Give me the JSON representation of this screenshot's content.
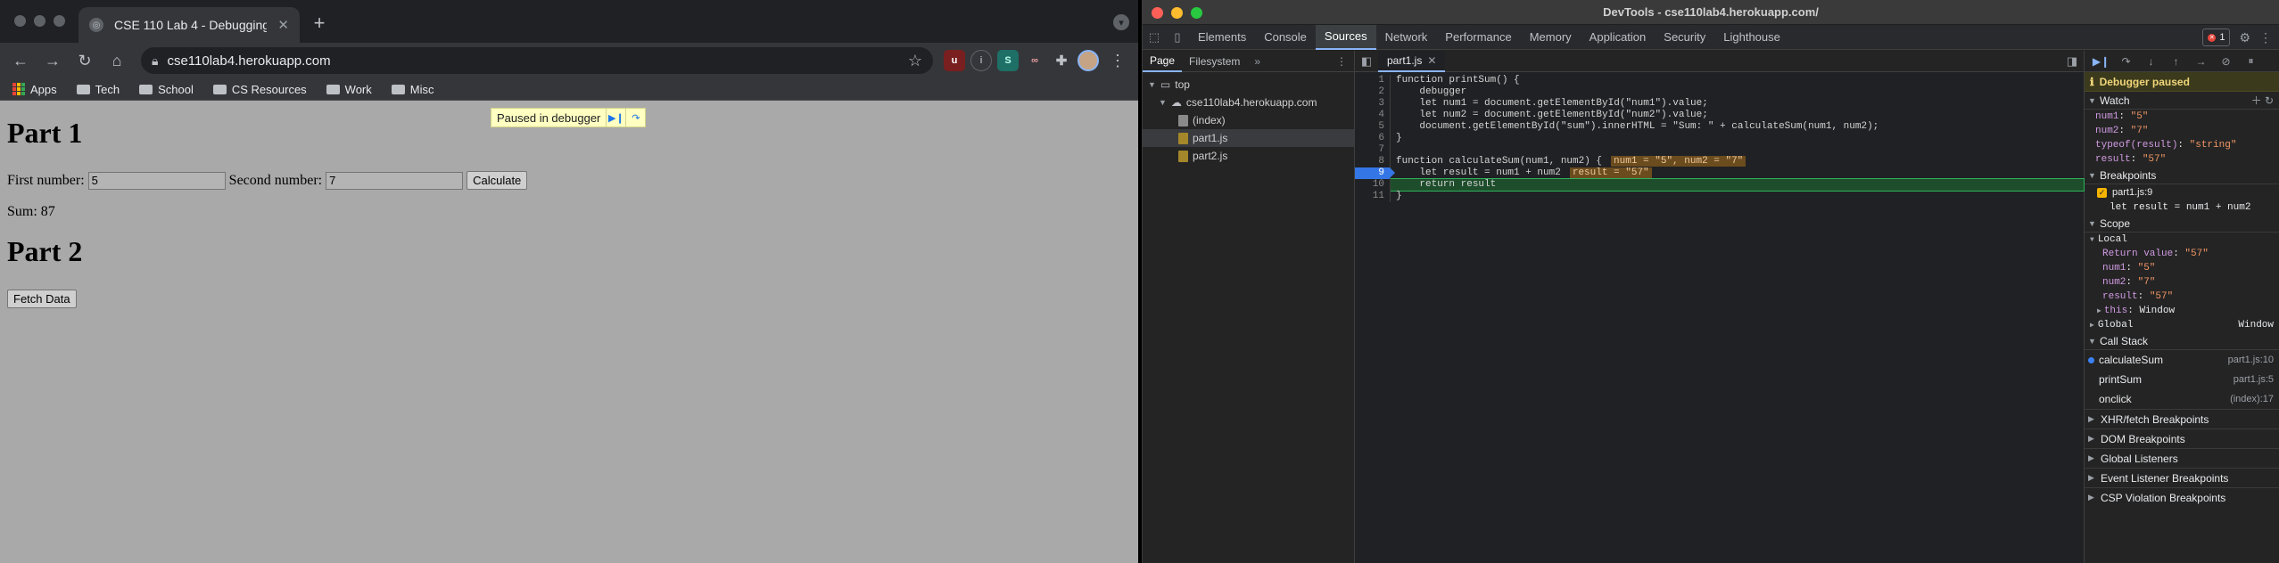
{
  "browser": {
    "tab_title": "CSE 110 Lab 4 - Debugging",
    "url": "cse110lab4.herokuapp.com",
    "bookmarks": [
      {
        "label": "Apps",
        "icon": "apps-grid-icon"
      },
      {
        "label": "Tech",
        "icon": "folder-icon"
      },
      {
        "label": "School",
        "icon": "folder-icon"
      },
      {
        "label": "CS Resources",
        "icon": "folder-icon"
      },
      {
        "label": "Work",
        "icon": "folder-icon"
      },
      {
        "label": "Misc",
        "icon": "folder-icon"
      }
    ],
    "extensions": [
      "ublock-icon",
      "extension-icon",
      "s-extension-icon",
      "glasses-extension-icon",
      "puzzle-icon"
    ]
  },
  "page": {
    "paused_label": "Paused in debugger",
    "part1_heading": "Part 1",
    "first_label": "First number:",
    "first_value": "5",
    "second_label": "Second number:",
    "second_value": "7",
    "calculate_label": "Calculate",
    "sum_text": "Sum: 87",
    "part2_heading": "Part 2",
    "fetch_label": "Fetch Data"
  },
  "devtools": {
    "window_title": "DevTools - cse110lab4.herokuapp.com/",
    "tabs": [
      "Elements",
      "Console",
      "Sources",
      "Network",
      "Performance",
      "Memory",
      "Application",
      "Security",
      "Lighthouse"
    ],
    "active_tab": "Sources",
    "error_count": "1",
    "nav_tabs": [
      "Page",
      "Filesystem"
    ],
    "tree": {
      "top": "top",
      "host": "cse110lab4.herokuapp.com",
      "files": [
        "(index)",
        "part1.js",
        "part2.js"
      ],
      "selected": "part1.js"
    },
    "editor_tab": "part1.js",
    "code": [
      {
        "n": "1",
        "text": "function printSum() {"
      },
      {
        "n": "2",
        "text": "    debugger"
      },
      {
        "n": "3",
        "text": "    let num1 = document.getElementById(\"num1\").value;"
      },
      {
        "n": "4",
        "text": "    let num2 = document.getElementById(\"num2\").value;"
      },
      {
        "n": "5",
        "text": "    document.getElementById(\"sum\").innerHTML = \"Sum: \" + calculateSum(num1, num2);"
      },
      {
        "n": "6",
        "text": "}"
      },
      {
        "n": "7",
        "text": ""
      },
      {
        "n": "8",
        "text": "function calculateSum(num1, num2) {",
        "inline": "num1 = \"5\", num2 = \"7\""
      },
      {
        "n": "9",
        "text": "    let result = num1 + num2",
        "inline": "result = \"57\"",
        "breakpoint": true
      },
      {
        "n": "10",
        "text": "    return result",
        "exec": true
      },
      {
        "n": "11",
        "text": "}"
      }
    ],
    "paused_banner": "Debugger paused",
    "watch_title": "Watch",
    "watch": [
      {
        "key": "num1",
        "value": "\"5\""
      },
      {
        "key": "num2",
        "value": "\"7\""
      },
      {
        "key": "typeof(result)",
        "value": "\"string\""
      },
      {
        "key": "result",
        "value": "\"57\""
      }
    ],
    "breakpoints_title": "Breakpoints",
    "breakpoint": {
      "file": "part1.js:9",
      "code": "let result = num1 + num2"
    },
    "scope_title": "Scope",
    "local_title": "Local",
    "locals": [
      {
        "key": "Return value",
        "value": "\"57\""
      },
      {
        "key": "num1",
        "value": "\"5\""
      },
      {
        "key": "num2",
        "value": "\"7\""
      },
      {
        "key": "result",
        "value": "\"57\""
      },
      {
        "key": "this",
        "value": "Window"
      }
    ],
    "global_title": "Global",
    "global_value": "Window",
    "callstack_title": "Call Stack",
    "frames": [
      {
        "name": "calculateSum",
        "loc": "part1.js:10",
        "current": true
      },
      {
        "name": "printSum",
        "loc": "part1.js:5"
      },
      {
        "name": "onclick",
        "loc": "(index):17"
      }
    ],
    "more_sections": [
      "XHR/fetch Breakpoints",
      "DOM Breakpoints",
      "Global Listeners",
      "Event Listener Breakpoints",
      "CSP Violation Breakpoints"
    ],
    "colors": {
      "accent": "#8ab4f8",
      "breakpoint": "#3576e6",
      "paused": "#f0d67a"
    }
  }
}
